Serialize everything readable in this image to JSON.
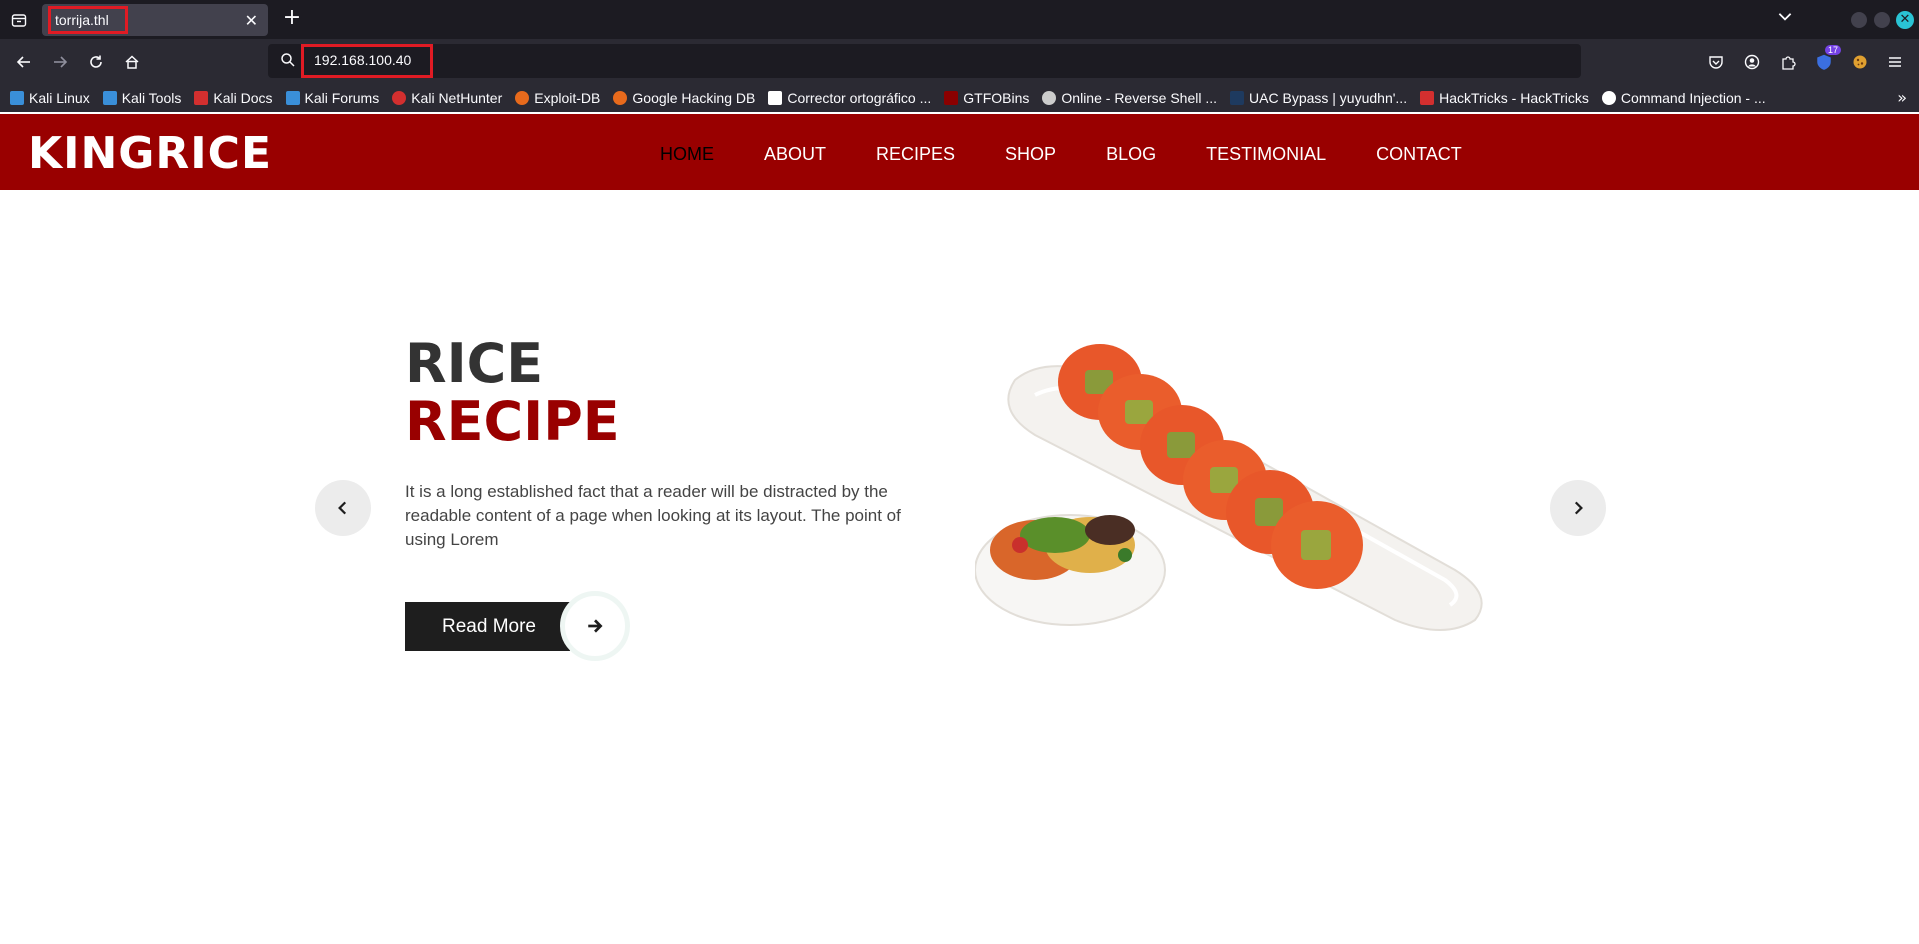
{
  "browser": {
    "tab": {
      "title": "torrija.thl"
    },
    "url": "192.168.100.40",
    "extension_badge": "17",
    "bookmarks": [
      {
        "label": "Kali Linux",
        "color": "#3a8fd9"
      },
      {
        "label": "Kali Tools",
        "color": "#3a8fd9"
      },
      {
        "label": "Kali Docs",
        "color": "#d32f2f"
      },
      {
        "label": "Kali Forums",
        "color": "#3a8fd9"
      },
      {
        "label": "Kali NetHunter",
        "color": "#d32f2f"
      },
      {
        "label": "Exploit-DB",
        "color": "#e86a1c"
      },
      {
        "label": "Google Hacking DB",
        "color": "#e86a1c"
      },
      {
        "label": "Corrector ortográfico ...",
        "color": "#ffffff"
      },
      {
        "label": "GTFOBins",
        "color": "#8b0000"
      },
      {
        "label": "Online - Reverse Shell ...",
        "color": "#cccccc"
      },
      {
        "label": "UAC Bypass | yuyudhn'...",
        "color": "#1e3a5f"
      },
      {
        "label": "HackTricks - HackTricks",
        "color": "#d32f2f"
      },
      {
        "label": "Command Injection - ...",
        "color": "#ffffff"
      }
    ]
  },
  "site": {
    "logo": "KINGRICE",
    "menu": [
      "HOME",
      "ABOUT",
      "RECIPES",
      "SHOP",
      "BLOG",
      "TESTIMONIAL",
      "CONTACT"
    ],
    "active_menu": "HOME",
    "hero": {
      "title_line1": "RICE",
      "title_line2": "RECIPE",
      "text": "It is a long established fact that a reader will be distracted by the readable content of a page when looking at its layout. The point of using Lorem",
      "button_label": "Read More"
    },
    "colors": {
      "brand": "#990000",
      "dark": "#1e1e1e"
    }
  }
}
